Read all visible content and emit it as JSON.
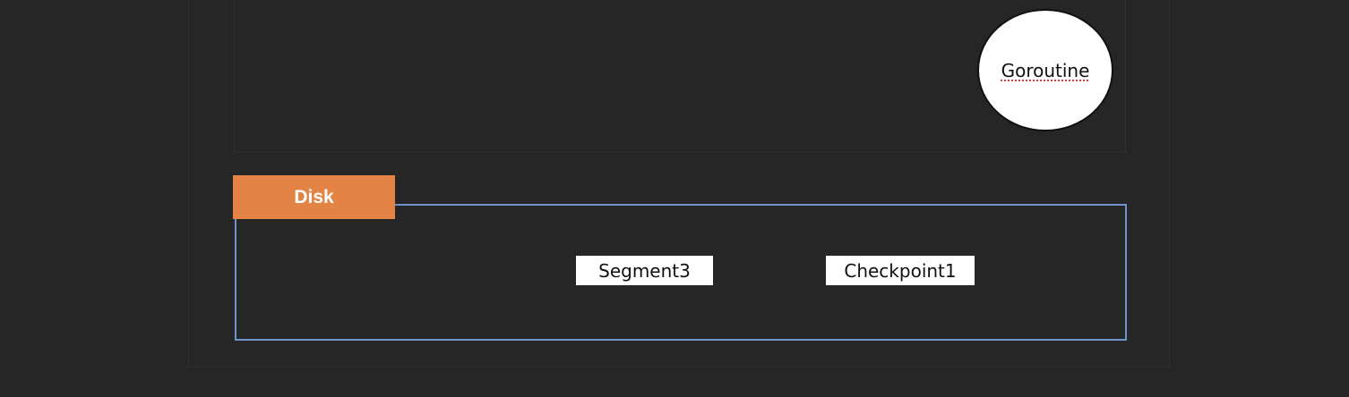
{
  "diagram": {
    "top_label": "",
    "goroutine": {
      "label": "Goroutine"
    },
    "disk": {
      "label": "Disk",
      "items": [
        {
          "label": "Segment3"
        },
        {
          "label": "Checkpoint1"
        }
      ]
    }
  },
  "colors": {
    "background": "#262626",
    "disk_tab": "#e38446",
    "disk_border": "#6f93c8",
    "node_fill": "#ffffff"
  }
}
